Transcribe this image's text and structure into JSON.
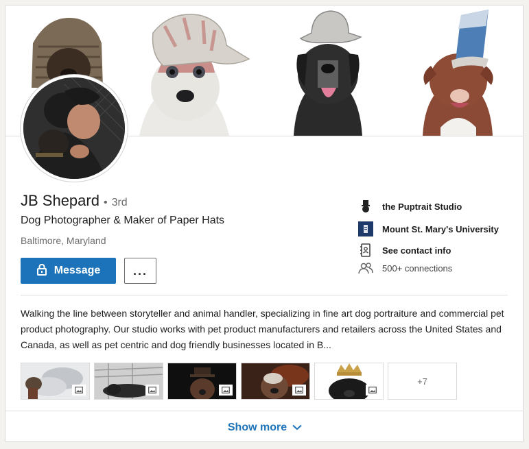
{
  "profile": {
    "name": "JB Shepard",
    "degree_dot": "•",
    "degree": "3rd",
    "headline": "Dog Photographer & Maker of Paper Hats",
    "location": "Baltimore, Maryland"
  },
  "actions": {
    "message_label": "Message",
    "more_label": "..."
  },
  "sidebar": {
    "company": "the Puptrait Studio",
    "school": "Mount St. Mary's University",
    "contact": "See contact info",
    "connections": "500+ connections"
  },
  "summary": {
    "text": "Walking the line between storyteller and animal handler, specializing in fine art dog portraiture and commercial pet product photography. Our studio works with pet product manufacturers and retailers across the United States and Canada, as well as pet centric and dog friendly businesses located in B..."
  },
  "media": {
    "more_count": "+7"
  },
  "footer": {
    "show_more_label": "Show more"
  },
  "colors": {
    "accent": "#1c73b9",
    "muted_text": "#6b6b6b"
  }
}
